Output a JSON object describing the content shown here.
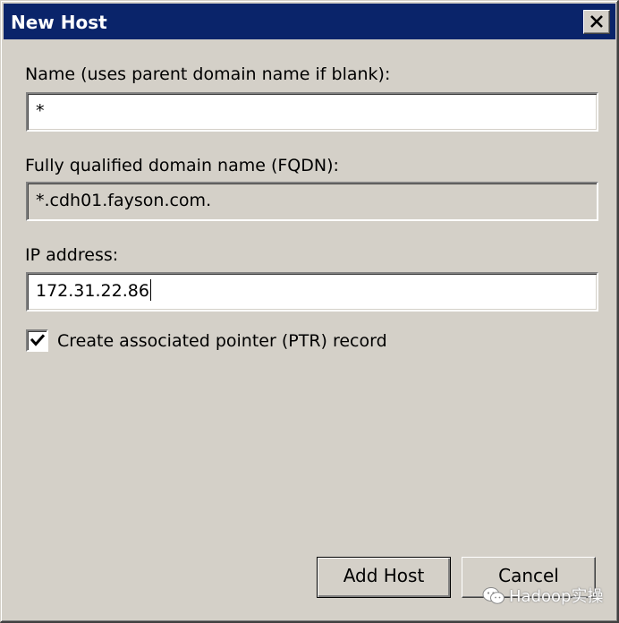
{
  "window": {
    "title": "New Host",
    "close_icon": "close-x-icon"
  },
  "form": {
    "name_label": "Name (uses parent domain name if blank):",
    "name_value": "*",
    "fqdn_label": "Fully qualified domain name (FQDN):",
    "fqdn_value": "*.cdh01.fayson.com.",
    "ip_label": "IP address:",
    "ip_value": "172.31.22.86",
    "ptr_checkbox_label": "Create associated pointer (PTR) record",
    "ptr_checked": true
  },
  "buttons": {
    "add_host": "Add Host",
    "cancel": "Cancel"
  },
  "watermark": {
    "text": "Hadoop实操",
    "icon": "wechat-icon"
  },
  "colors": {
    "titlebar": "#0a246a",
    "dialog_face": "#d4d0c8",
    "field_bg": "#ffffff"
  }
}
